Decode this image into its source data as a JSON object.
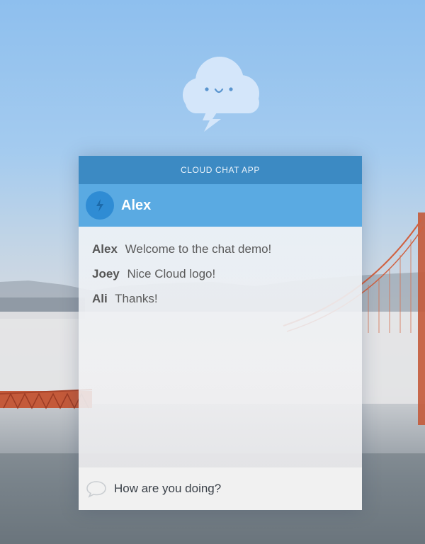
{
  "app": {
    "title": "CLOUD CHAT APP",
    "brand_color": "#3c8ac3",
    "accent_color": "#5aaae2"
  },
  "logo": {
    "icon": "cloud-lightning-icon"
  },
  "user": {
    "name": "Alex",
    "icon": "lightning-bolt-icon"
  },
  "messages": [
    {
      "author": "Alex",
      "text": "Welcome to the chat demo!"
    },
    {
      "author": "Joey",
      "text": "Nice Cloud logo!"
    },
    {
      "author": "Ali",
      "text": "Thanks!"
    }
  ],
  "composer": {
    "value": "How are you doing?",
    "icon": "speech-bubble-icon"
  }
}
